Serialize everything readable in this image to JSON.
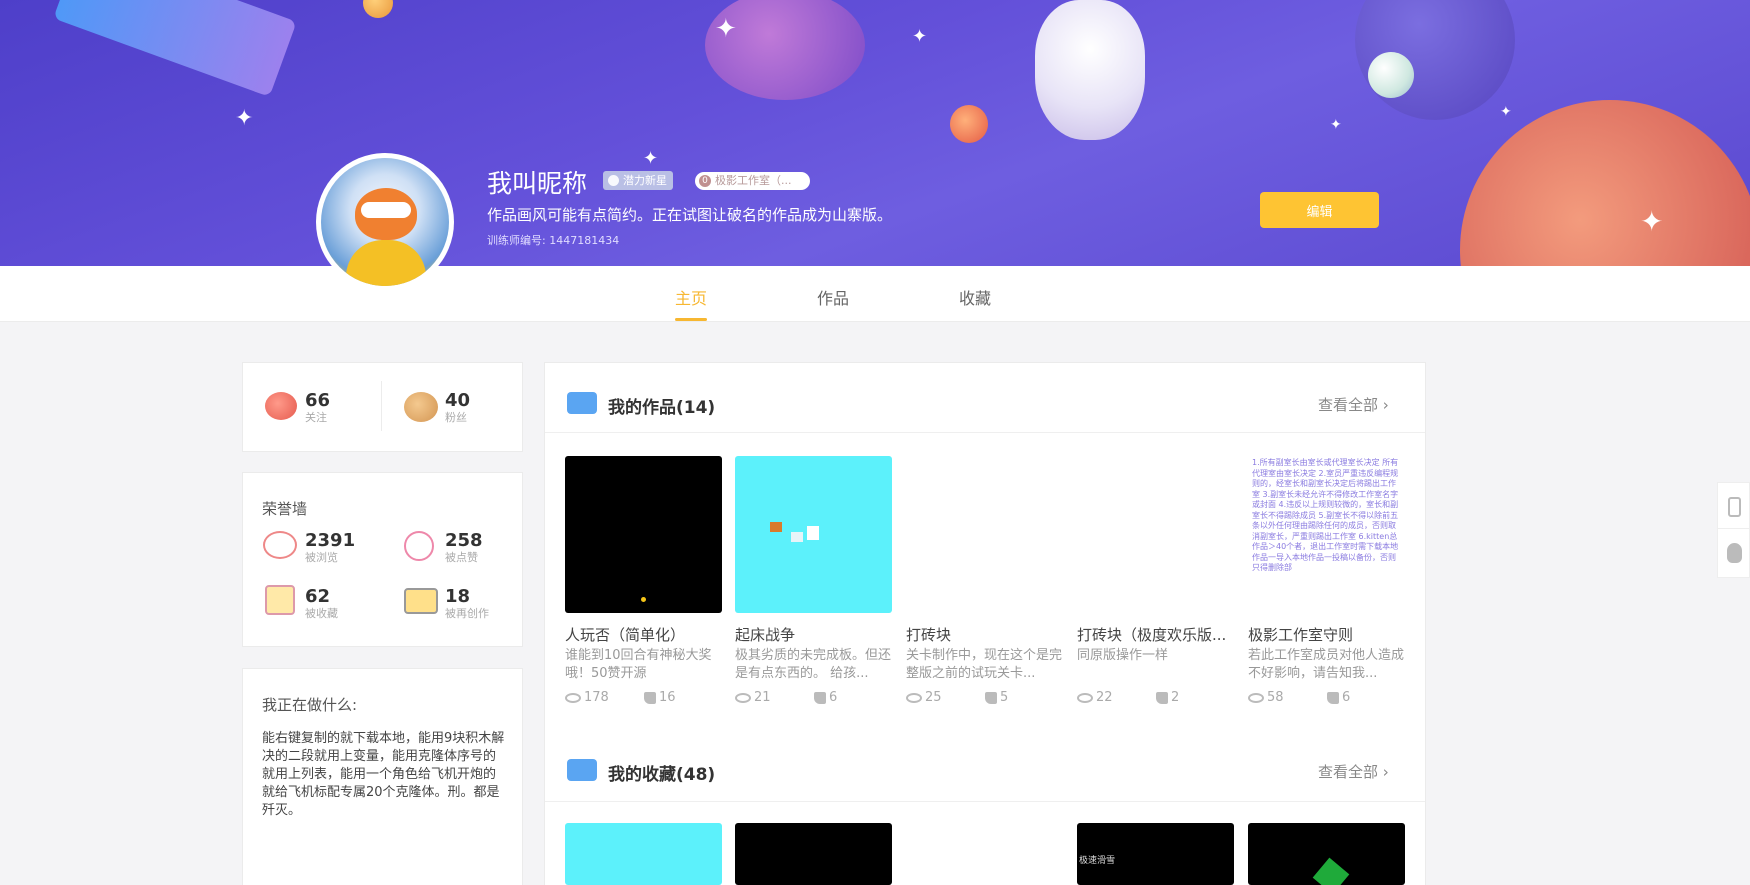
{
  "profile": {
    "name": "我叫昵称",
    "badge_level": "潜力新星",
    "badge_studio": "极影工作室（...",
    "bio": "作品画风可能有点简约。正在试图让破名的作品成为山寨版。",
    "trainer_id": "训练师编号: 1447181434",
    "edit_label": "编辑"
  },
  "tabs": [
    "主页",
    "作品",
    "收藏"
  ],
  "follow": {
    "following": {
      "value": "66",
      "label": "关注"
    },
    "fans": {
      "value": "40",
      "label": "粉丝"
    }
  },
  "honor": {
    "title": "荣誉墙",
    "views": {
      "value": "2391",
      "label": "被浏览"
    },
    "likes": {
      "value": "258",
      "label": "被点赞"
    },
    "favorites": {
      "value": "62",
      "label": "被收藏"
    },
    "remixes": {
      "value": "18",
      "label": "被再创作"
    }
  },
  "doing": {
    "title": "我正在做什么:",
    "text": "能右键复制的就下载本地，能用9块积木解决的二段就用上变量，能用克隆体序号的就用上列表，能用一个角色给飞机开炮的就给飞机标配专属20个克隆体。刑。都是歼灭。"
  },
  "works": {
    "title": "我的作品(14)",
    "see_all": "查看全部",
    "items": [
      {
        "title": "人玩否（简单化）",
        "desc": "谁能到10回合有神秘大奖哦！50赞开源",
        "views": "178",
        "likes": "16"
      },
      {
        "title": "起床战争",
        "desc": "极其劣质的未完成板。但还是有点东西的。 给孩...",
        "views": "21",
        "likes": "6"
      },
      {
        "title": "打砖块",
        "desc": "关卡制作中，现在这个是完整版之前的试玩关卡...",
        "views": "25",
        "likes": "5"
      },
      {
        "title": "打砖块（极度欢乐版...",
        "desc": "同原版操作一样",
        "views": "22",
        "likes": "2"
      },
      {
        "title": "极影工作室守则",
        "desc": "若此工作室成员对他人造成不好影响，请告知我...",
        "views": "58",
        "likes": "6"
      }
    ],
    "rules_thumb_text": "1.所有副室长由室长或代理室长决定 所有代理室由室长决定 2.室员严重违反编程规则的，经室长和副室长决定后将踢出工作室 3.副室长未经允许不得修改工作室名字或封面 4.违反以上规则较微的，室长和副室长不得踢除成员 5.副室长不得以除前五条以外任何理由踢除任何的成员，否则取消副室长，严重则踢出工作室 6.kitten总作品＞40个者，退出工作室时需下载本地作品一导入本地作品一投稿以备份，否则只得删除部"
  },
  "collections": {
    "title": "我的收藏(48)",
    "see_all": "查看全部",
    "thumb_caption": "极速滑雪"
  },
  "colors": {
    "accent": "#f7b731",
    "edit_button": "#fec433",
    "banner": "#5a48cf"
  }
}
